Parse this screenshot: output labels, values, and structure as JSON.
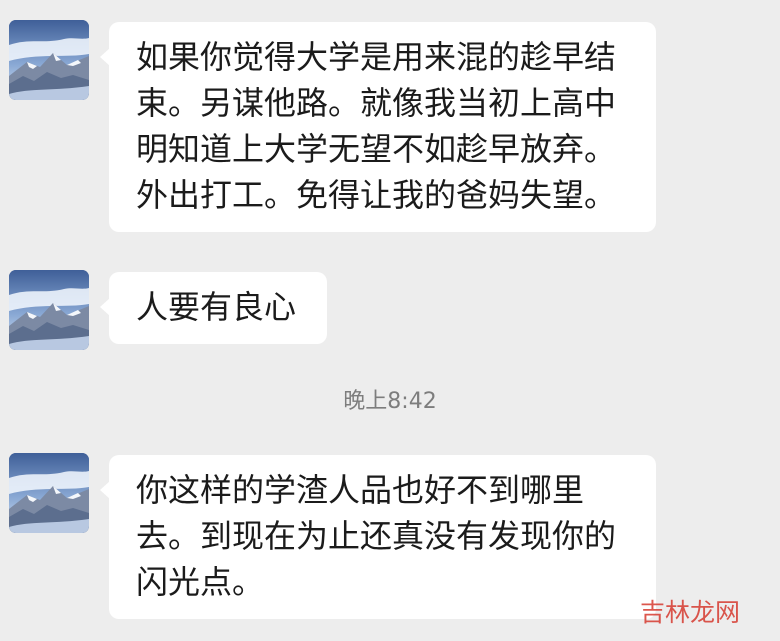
{
  "chat": {
    "messages": [
      {
        "lines": [
          "如果你觉得大学是用来混的趁早结",
          "束。另谋他路。就像我当初上高中",
          "明知道上大学无望不如趁早放弃。",
          "外出打工。免得让我的爸妈失望。"
        ],
        "avatar_icon": "mountain-avatar-icon"
      },
      {
        "lines": [
          "人要有良心"
        ],
        "avatar_icon": "mountain-avatar-icon"
      },
      {
        "lines": [
          "你这样的学渣人品也好不到哪里",
          "去。到现在为止还真没有发现你的",
          "闪光点。"
        ],
        "avatar_icon": "mountain-avatar-icon"
      }
    ],
    "timestamp": "晚上8:42"
  },
  "watermark": {
    "text": "吉林龙网"
  },
  "colors": {
    "background": "#ededed",
    "bubble": "#ffffff",
    "text": "#1b1b1b",
    "timestamp": "#7d7d7d",
    "watermark": "#d63a2f"
  }
}
